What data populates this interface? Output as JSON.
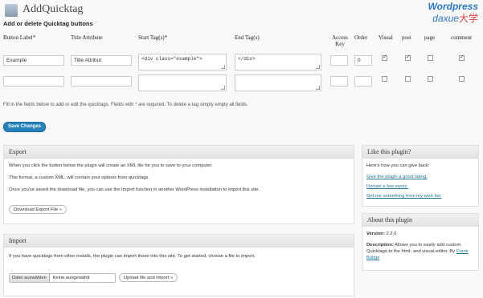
{
  "page": {
    "title": "AddQuicktag",
    "section_title": "Add or delete Quicktag buttons"
  },
  "watermark": {
    "line1": "Wordpress",
    "line2": "daxue",
    "cn": "大学"
  },
  "table": {
    "headers": [
      "Button Label*",
      "Title Attribute",
      "Start Tag(s)*",
      "End Tag(s)",
      "Access Key",
      "Order",
      "Visual",
      "post",
      "page",
      "comment"
    ],
    "rows": [
      {
        "label": "Example",
        "title": "Title Attribut",
        "start": "<div class=\"example\">",
        "end": "</div>",
        "access": "",
        "order": "0",
        "visual": true,
        "post": true,
        "page": false,
        "comment": true
      },
      {
        "label": "",
        "title": "",
        "start": "",
        "end": "",
        "access": "",
        "order": "",
        "visual": false,
        "post": false,
        "page": false,
        "comment": false
      }
    ]
  },
  "hint": "Fill in the fields below to add or edit the quicktags. Fields with * are required. To delete a tag simply empty all fields.",
  "save_label": "Save Changes",
  "export": {
    "title": "Export",
    "p1": "When you click the button below the plugin will create an XML file for you to save to your computer.",
    "p2": "This format, a custom XML, will contain your options from quicktags.",
    "p3": "Once you've saved the download file, you can use the Import function in another WordPress installation to import this site.",
    "button": "Download Export File »"
  },
  "import": {
    "title": "Import",
    "p1": "If you have quicktags from other installs, the plugin can import those into this site. To get started, choose a file to import.",
    "file_button": "Datei auswählen",
    "file_status": "Keine ausgewählt",
    "upload_button": "Upload file and import »"
  },
  "like": {
    "title": "Like this plugin?",
    "intro": "Here's how you can give back:",
    "links": [
      "Give the plugin a good rating.",
      "Donate a few euros.",
      "Get me something from my wish list."
    ]
  },
  "about": {
    "title": "About this plugin",
    "version_label": "Version:",
    "version": "2.2.0",
    "desc_label": "Description:",
    "desc_text": "Allows you to easily add custom Quicktags to the html- and visual-editor. By",
    "author": "Frank Bültge"
  },
  "colors": {
    "primary": "#2680ba",
    "link": "#21759b"
  }
}
